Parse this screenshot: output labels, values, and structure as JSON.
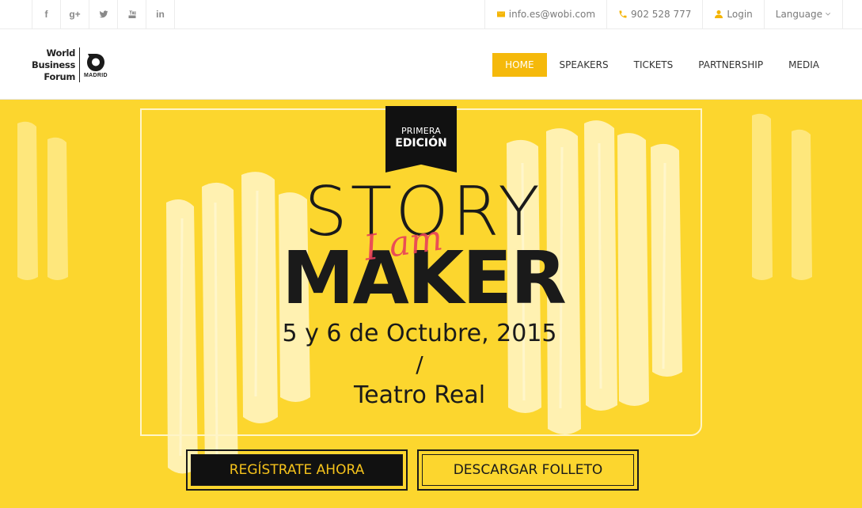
{
  "social": {
    "facebook": "f",
    "googleplus": "g+",
    "icons": [
      "facebook-icon",
      "google-plus-icon",
      "twitter-icon",
      "youtube-icon",
      "linkedin-icon"
    ],
    "linkedin": "in"
  },
  "contact": {
    "email": "info.es@wobi.com",
    "phone": "902 528 777",
    "login": "Login",
    "language": "Language"
  },
  "logo": {
    "line1": "World",
    "line2": "Business",
    "line3": "Forum",
    "sub": "MADRID"
  },
  "nav": {
    "items": [
      "HOME",
      "SPEAKERS",
      "TICKETS",
      "PARTNERSHIP",
      "MEDIA"
    ],
    "active": "HOME"
  },
  "hero": {
    "badge_line1": "PRIMERA",
    "badge_line2": "EDICIÓN",
    "title_top": "STORY",
    "title_script": "I am",
    "title_bottom": "MAKER",
    "date": "5 y 6 de Octubre, 2015",
    "slash": "/",
    "venue": "Teatro Real",
    "register_label": "REGÍSTRATE AHORA",
    "brochure_label": "DESCARGAR FOLLETO"
  },
  "colors": {
    "accent": "#f5b90b",
    "hero_bg": "#fcd62e",
    "dark": "#1a1a1a",
    "script": "#e8405a"
  }
}
